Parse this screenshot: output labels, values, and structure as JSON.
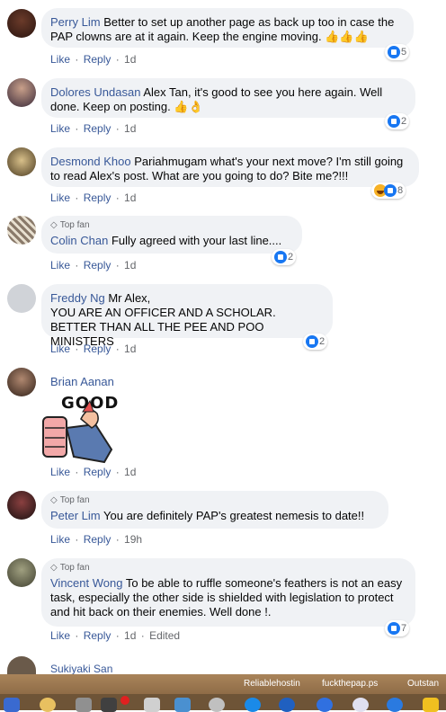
{
  "comments": [
    {
      "author": "Perry Lim",
      "text": "Better to set up another page as back up too in case the PAP clowns are at it again. Keep the engine moving. 👍👍👍",
      "like": "Like",
      "reply": "Reply",
      "time": "1d",
      "reactions": "5"
    },
    {
      "author": "Dolores Undasan",
      "text": "Alex Tan, it's good to see you here again. Well done. Keep on posting. 👍👌",
      "like": "Like",
      "reply": "Reply",
      "time": "1d",
      "reactions": "2"
    },
    {
      "author": "Desmond Khoo",
      "text": "Pariahmugam what's your next move? I'm still going to read Alex's post. What are you going to do? Bite me?!!!",
      "like": "Like",
      "reply": "Reply",
      "time": "1d",
      "reactions": "8"
    },
    {
      "badge": "Top fan",
      "author": "Colin Chan",
      "text": "Fully agreed with your last line....",
      "like": "Like",
      "reply": "Reply",
      "time": "1d",
      "reactions": "2"
    },
    {
      "author": "Freddy Ng",
      "text_lines": [
        "Mr Alex,",
        "YOU ARE AN OFFICER AND A SCHOLAR.",
        "BETTER THAN ALL THE PEE AND POO MINISTERS"
      ],
      "like": "Like",
      "reply": "Reply",
      "time": "1d",
      "reactions": "2"
    },
    {
      "author": "Brian Aanan",
      "sticker_text": "GOOD",
      "like": "Like",
      "reply": "Reply",
      "time": "1d"
    },
    {
      "badge": "Top fan",
      "author": "Peter Lim",
      "text": "You are definitely PAP's greatest nemesis to date!!",
      "like": "Like",
      "reply": "Reply",
      "time": "19h"
    },
    {
      "badge": "Top fan",
      "author": "Vincent Wong",
      "text": "To be able to ruffle someone's feathers is not an easy task, especially the other side is shielded with legislation to protect and hit back on their enemies. Well done !.",
      "like": "Like",
      "reply": "Reply",
      "time": "1d",
      "edited": "Edited",
      "reactions": "7"
    },
    {
      "author": "Sukiyaki San"
    }
  ],
  "taskbar": {
    "items": [
      "Reliablehostin",
      "fuckthepap.ps",
      "Outstan"
    ]
  },
  "colors": {
    "link": "#385898",
    "bubble": "#f0f2f5",
    "like": "#1877f2",
    "meta": "#65676b"
  }
}
